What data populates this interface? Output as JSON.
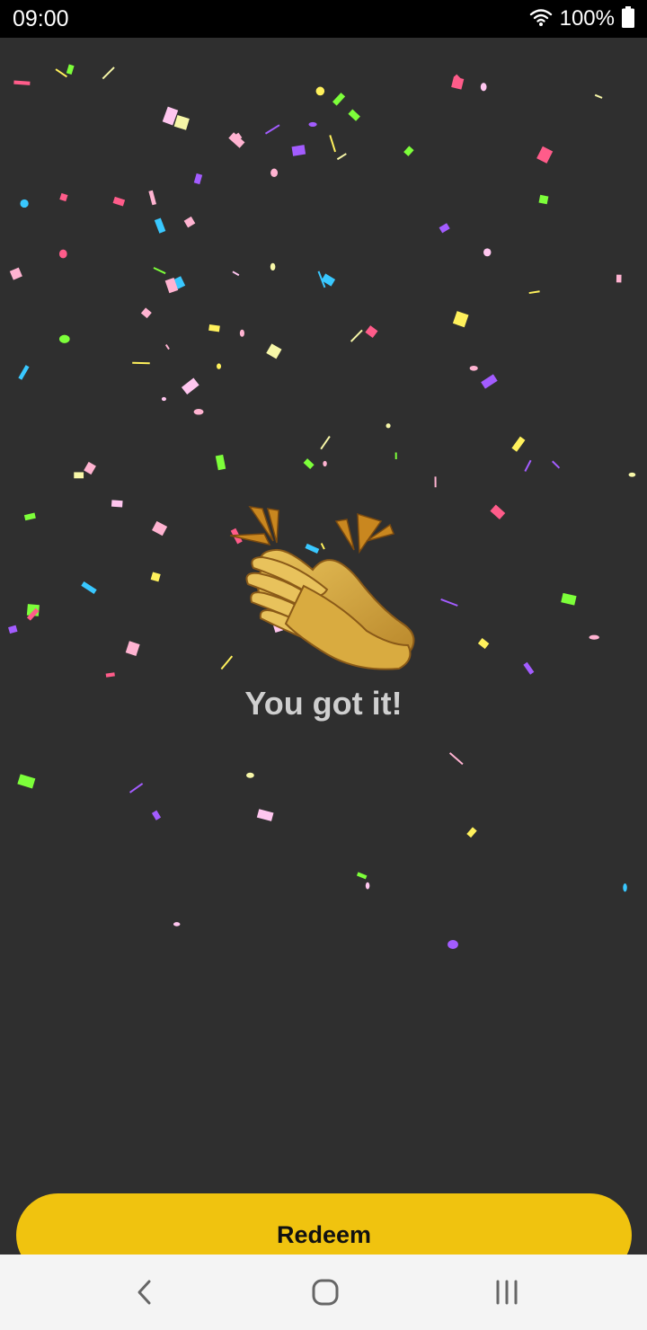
{
  "status_bar": {
    "time": "09:00",
    "battery_percent": "100%",
    "icons": [
      "wifi-icon",
      "battery-icon"
    ]
  },
  "celebration": {
    "emoji": "clapping-hands-icon",
    "headline": "You got it!"
  },
  "actions": {
    "redeem_label": "Redeem"
  },
  "navigation": {
    "icons": [
      "back-icon",
      "home-icon",
      "recents-icon"
    ]
  },
  "colors": {
    "background": "#2f2f2f",
    "accent": "#f0c30f",
    "headline": "#cfcfcf"
  }
}
